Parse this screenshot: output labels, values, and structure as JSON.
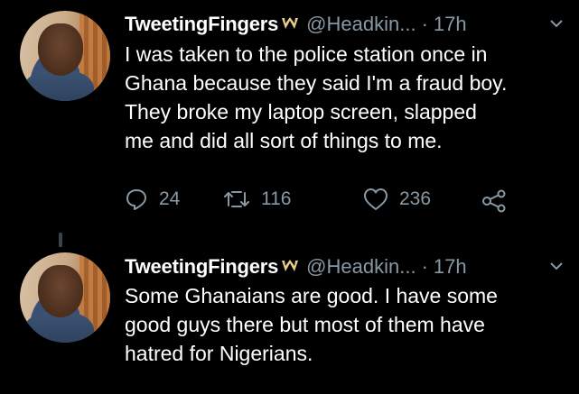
{
  "tweets": [
    {
      "display_name": "TweetingFingers",
      "badge_icon": "w-badge-icon",
      "handle": "@Headkin...",
      "separator": "·",
      "time": "17h",
      "lines": [
        "I was taken to the police station once in",
        "Ghana because they said I'm a fraud boy.",
        "They broke my laptop screen, slapped",
        "me and did all sort of things to me."
      ],
      "replies": "24",
      "retweets": "116",
      "likes": "236"
    },
    {
      "display_name": "TweetingFingers",
      "badge_icon": "w-badge-icon",
      "handle": "@Headkin...",
      "separator": "·",
      "time": "17h",
      "lines": [
        "Some Ghanaians are good. I have some",
        "good guys there but most of them have",
        "hatred for Nigerians."
      ]
    }
  ],
  "colors": {
    "background": "#000000",
    "text": "#ffffff",
    "muted": "#8899a6",
    "badge": "#e8cd8a",
    "thread_line": "#38444d"
  }
}
